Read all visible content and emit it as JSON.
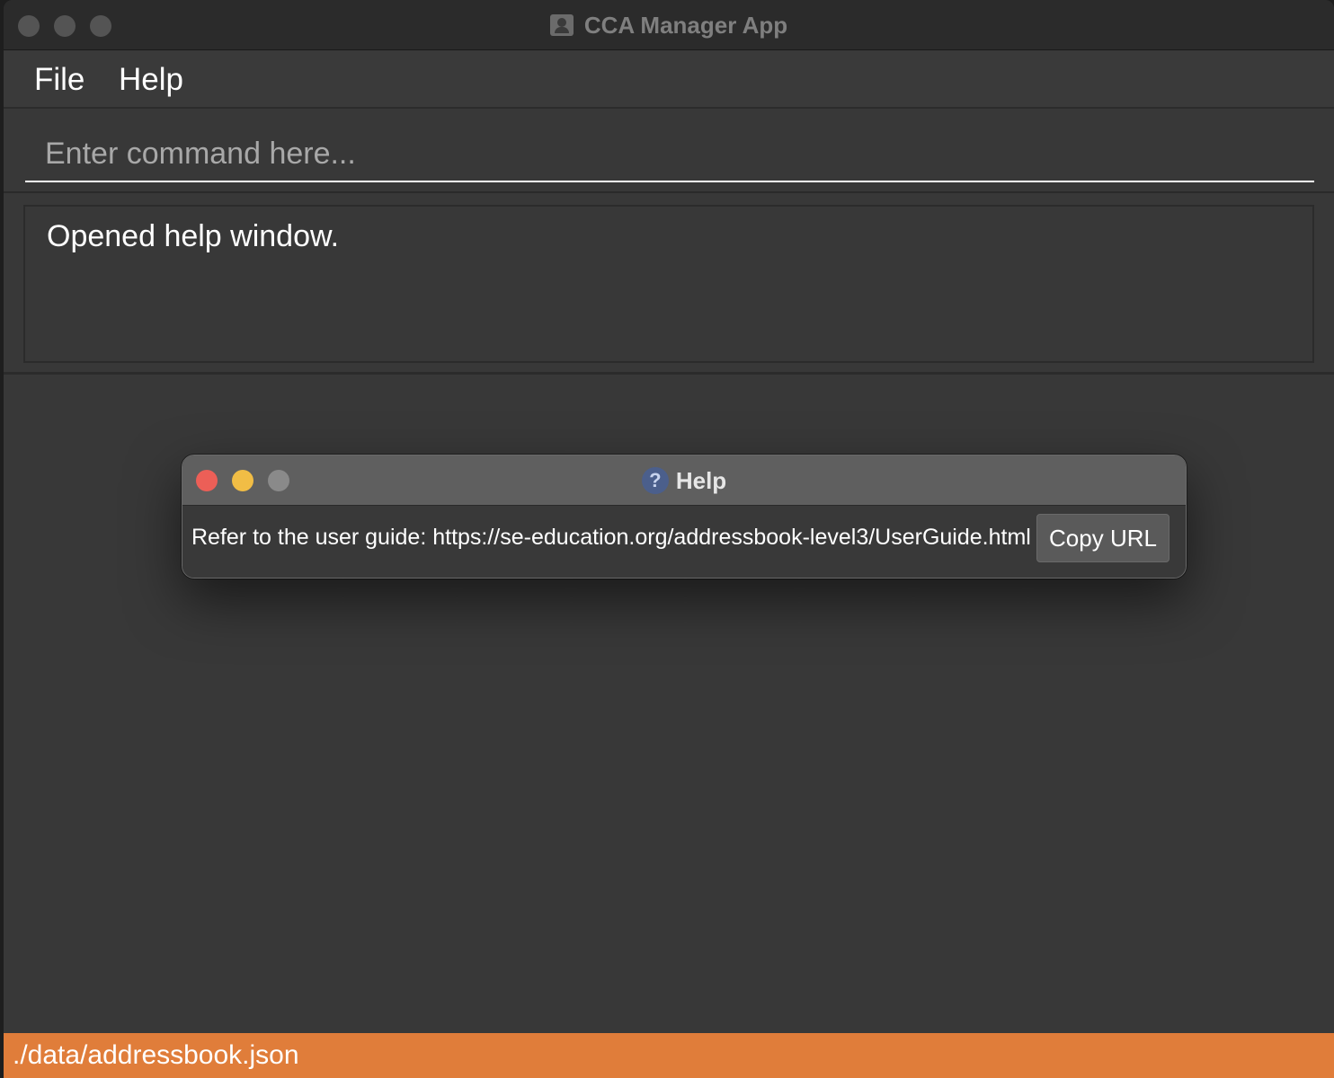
{
  "main_window": {
    "title": "CCA Manager App",
    "app_icon": "contact-card-icon",
    "menu": [
      {
        "label": "File"
      },
      {
        "label": "Help"
      }
    ],
    "command_box": {
      "placeholder": "Enter command here...",
      "value": ""
    },
    "result_display": {
      "text": "Opened help window."
    },
    "status_bar": {
      "path": "./data/addressbook.json",
      "color": "#e07d3a"
    }
  },
  "help_window": {
    "title": "Help",
    "icon": "question-mark-icon",
    "message": "Refer to the user guide: https://se-education.org/addressbook-level3/UserGuide.html",
    "copy_button_label": "Copy URL"
  },
  "colors": {
    "close": "#ec5f57",
    "minimize": "#f1bd45",
    "zoom_inactive": "#8a8a8a",
    "background": "#383838"
  }
}
